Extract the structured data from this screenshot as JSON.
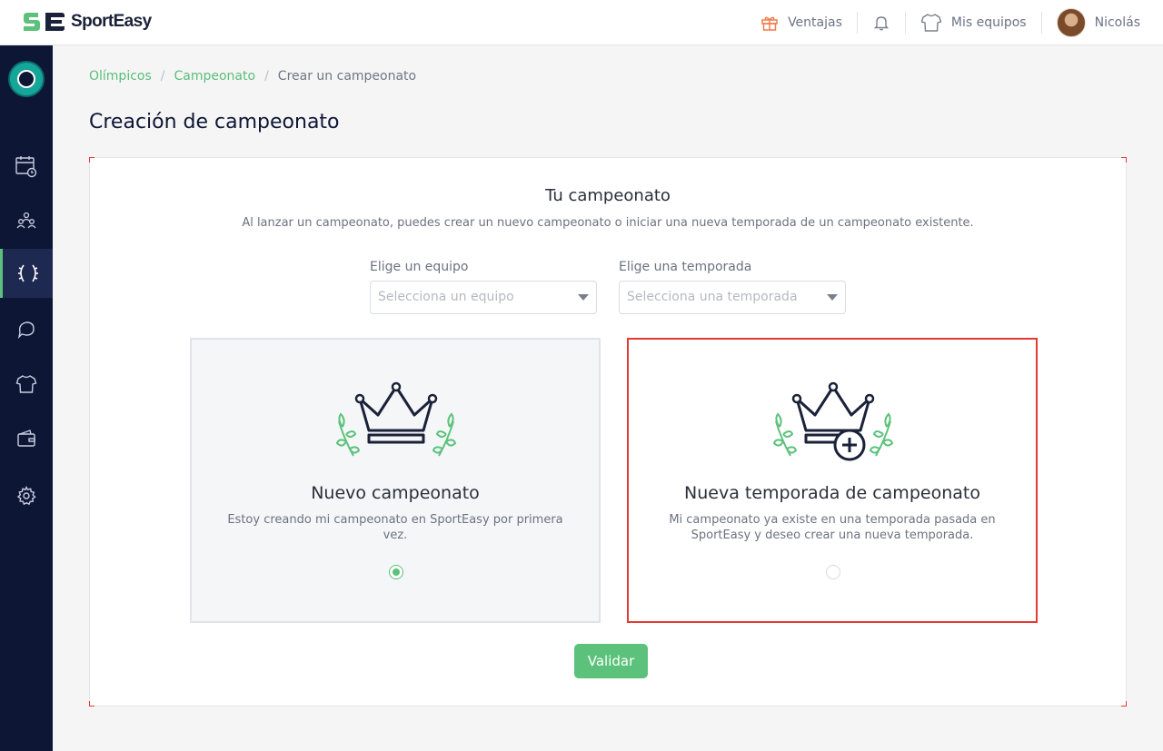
{
  "header": {
    "brand": "SportEasy",
    "items": [
      {
        "icon": "gift-icon",
        "label": "Ventajas"
      },
      {
        "icon": "bell-icon",
        "label": ""
      },
      {
        "icon": "jersey-icon",
        "label": "Mis equipos"
      },
      {
        "icon": "avatar",
        "label": "Nicolás"
      }
    ],
    "colors": {
      "gift": "#f07c4a",
      "brand_green": "#5cc27b",
      "brand_navy": "#1a2138"
    }
  },
  "sidebar": {
    "active_index": 2,
    "items": [
      {
        "icon": "calendar-icon"
      },
      {
        "icon": "team-icon"
      },
      {
        "icon": "laurel-icon"
      },
      {
        "icon": "chat-icon"
      },
      {
        "icon": "jersey-icon"
      },
      {
        "icon": "wallet-icon"
      },
      {
        "icon": "gear-icon"
      }
    ]
  },
  "breadcrumb": [
    "Olímpicos",
    "Campeonato",
    "Crear un campeonato"
  ],
  "page_title": "Creación de campeonato",
  "card": {
    "title": "Tu campeonato",
    "subtitle": "Al lanzar un campeonato, puedes crear un nuevo campeonato o iniciar una nueva temporada de un campeonato existente.",
    "team_field": {
      "label": "Elige un equipo",
      "placeholder": "Selecciona un equipo"
    },
    "season_field": {
      "label": "Elige una temporada",
      "placeholder": "Selecciona una temporada"
    },
    "options": [
      {
        "title": "Nuevo campeonato",
        "description": "Estoy creando mi campeonato en SportEasy por primera vez.",
        "selected": true
      },
      {
        "title": "Nueva temporada de campeonato",
        "description": "Mi campeonato ya existe en una temporada pasada en SportEasy y deseo crear una nueva temporada.",
        "selected": false
      }
    ],
    "submit_label": "Validar"
  }
}
